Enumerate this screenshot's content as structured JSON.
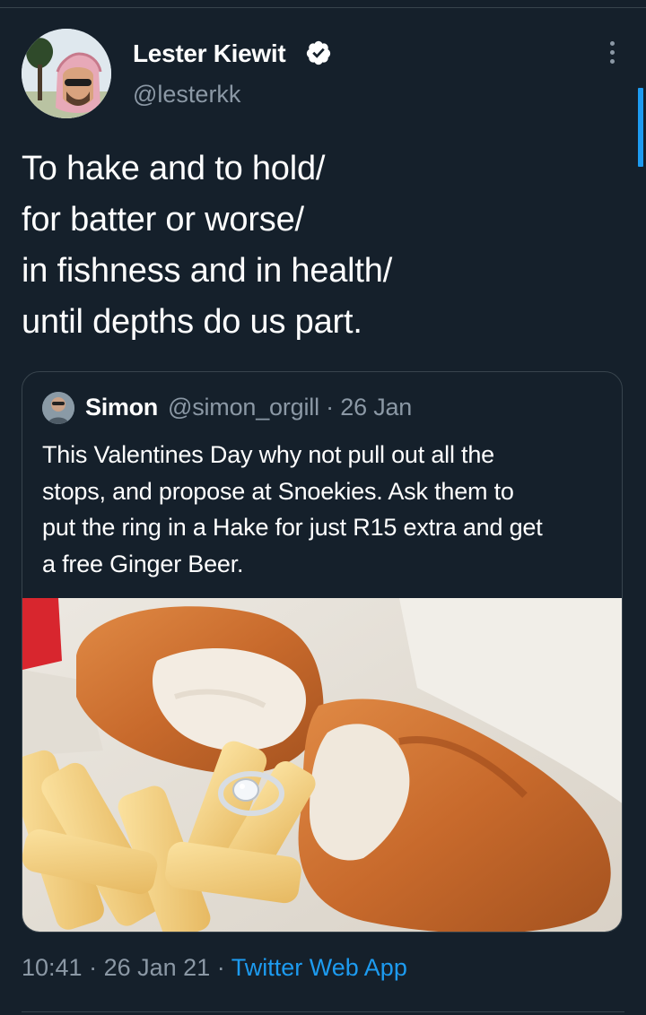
{
  "tweet": {
    "author_name": "Lester Kiewit",
    "author_handle": "@lesterkk",
    "verified": true,
    "text_lines": [
      "To hake and to hold/",
      "for batter or worse/",
      "in fishness and in health/",
      "until depths do us part."
    ],
    "time": "10:41",
    "date": "26 Jan 21",
    "client": "Twitter Web App",
    "separator": "·"
  },
  "quoted_tweet": {
    "author_name": "Simon",
    "author_handle": "@simon_orgill",
    "date": "26 Jan",
    "handle_date_line": "@simon_orgill · 26 Jan",
    "text_lines": [
      "This Valentines Day why not pull out all the",
      "stops, and propose at Snoekies. Ask them to",
      "put the ring in a Hake for just R15 extra and get",
      "a free Ginger Beer."
    ],
    "image_subject": "fish-and-chips-with-diamond-ring"
  },
  "icons": {
    "verified": "verified-badge-icon",
    "more": "more-options-icon"
  },
  "colors": {
    "background": "#15202b",
    "border": "#38444d",
    "secondary_text": "#8b98a5",
    "accent": "#1d9bf0"
  }
}
